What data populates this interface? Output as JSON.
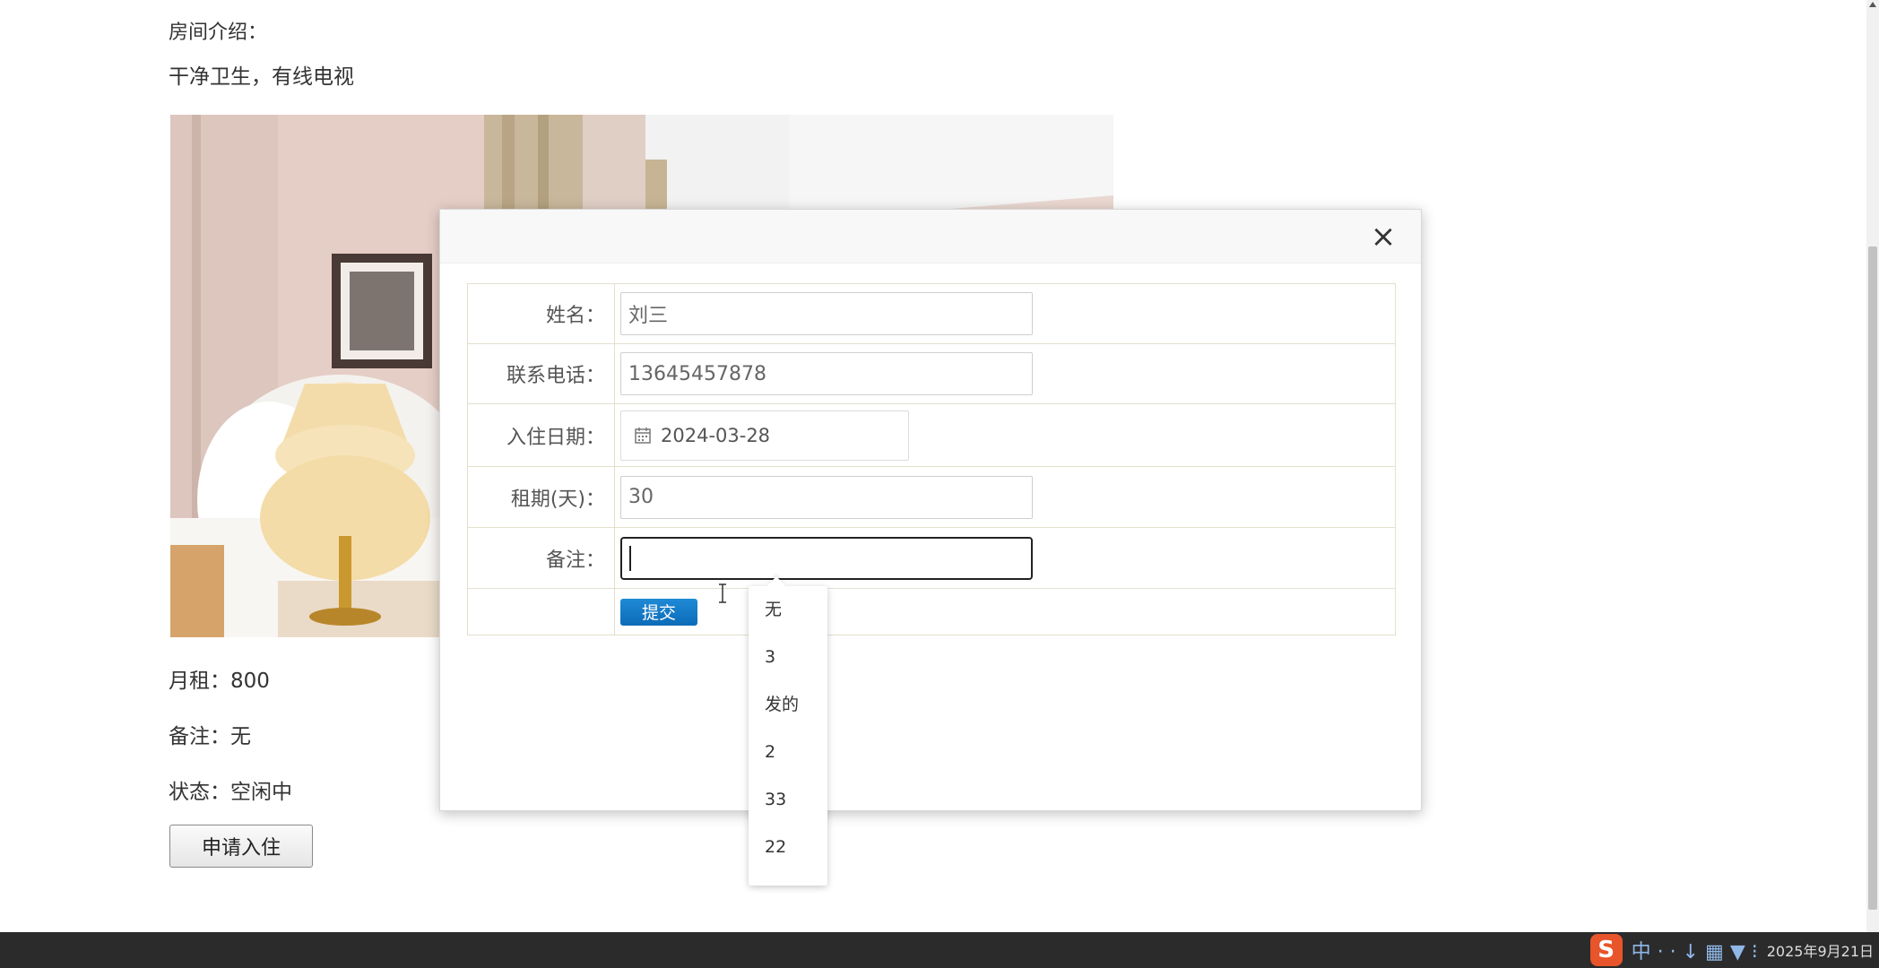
{
  "page": {
    "section_label": "房间介绍：",
    "intro_text": "干净卫生，有线电视",
    "rent_line": "月租：800",
    "remark_line": "备注：无",
    "status_line": "状态：空闲中",
    "apply_button": "申请入住"
  },
  "modal": {
    "close_symbol": "×",
    "fields": {
      "name_label": "姓名：",
      "name_value": "刘三",
      "phone_label": "联系电话：",
      "phone_value": "13645457878",
      "checkin_label": "入住日期：",
      "checkin_value": "2024-03-28",
      "lease_label": "租期(天)：",
      "lease_value": "30",
      "remark_label": "备注：",
      "remark_value": ""
    },
    "submit_label": "提交"
  },
  "autocomplete": {
    "options": [
      "无",
      "3",
      "发的",
      "2",
      "33",
      "22"
    ]
  },
  "taskbar": {
    "tray_glyphs": "中 · · ↓ ▦ ▼ ⁝",
    "date_text": "2025年9月21日"
  },
  "colors": {
    "submit_button": "#0c6cb8",
    "taskbar": "#2b2b2b",
    "table_border": "#e3e0cc"
  }
}
